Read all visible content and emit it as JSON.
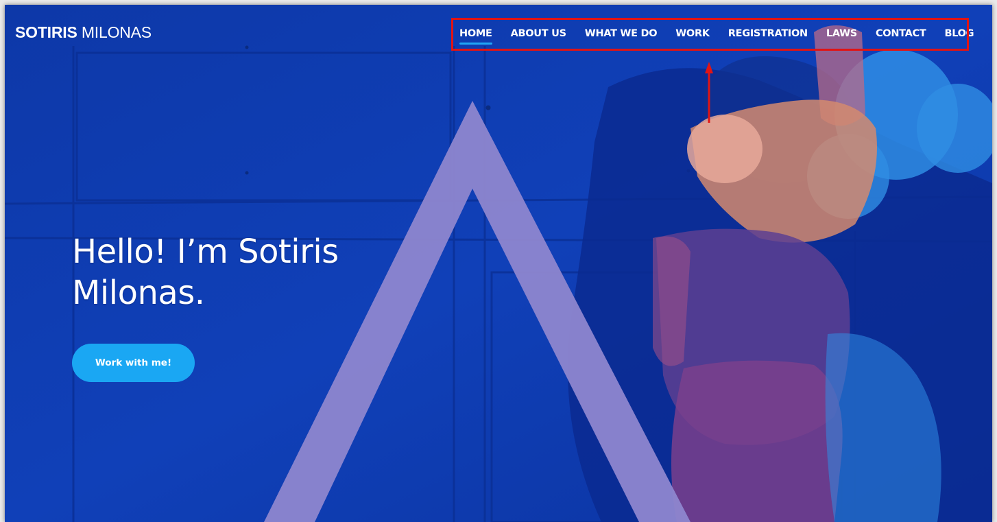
{
  "site": {
    "logo_bold": "SOTIRIS",
    "logo_light": "MILONAS"
  },
  "nav": {
    "items": [
      "HOME",
      "ABOUT US",
      "WHAT WE DO",
      "WORK",
      "REGISTRATION",
      "LAWS",
      "CONTACT",
      "BLOG"
    ],
    "active_index": 0
  },
  "hero": {
    "title": "Hello! I’m Sotiris Milonas.",
    "cta_label": "Work with me!"
  },
  "colors": {
    "background": "#0d3ab0",
    "accent": "#1aa7f3",
    "active_underline": "#20a6f5",
    "annotation_red": "#e11414",
    "triangle": "#8e86cf"
  }
}
